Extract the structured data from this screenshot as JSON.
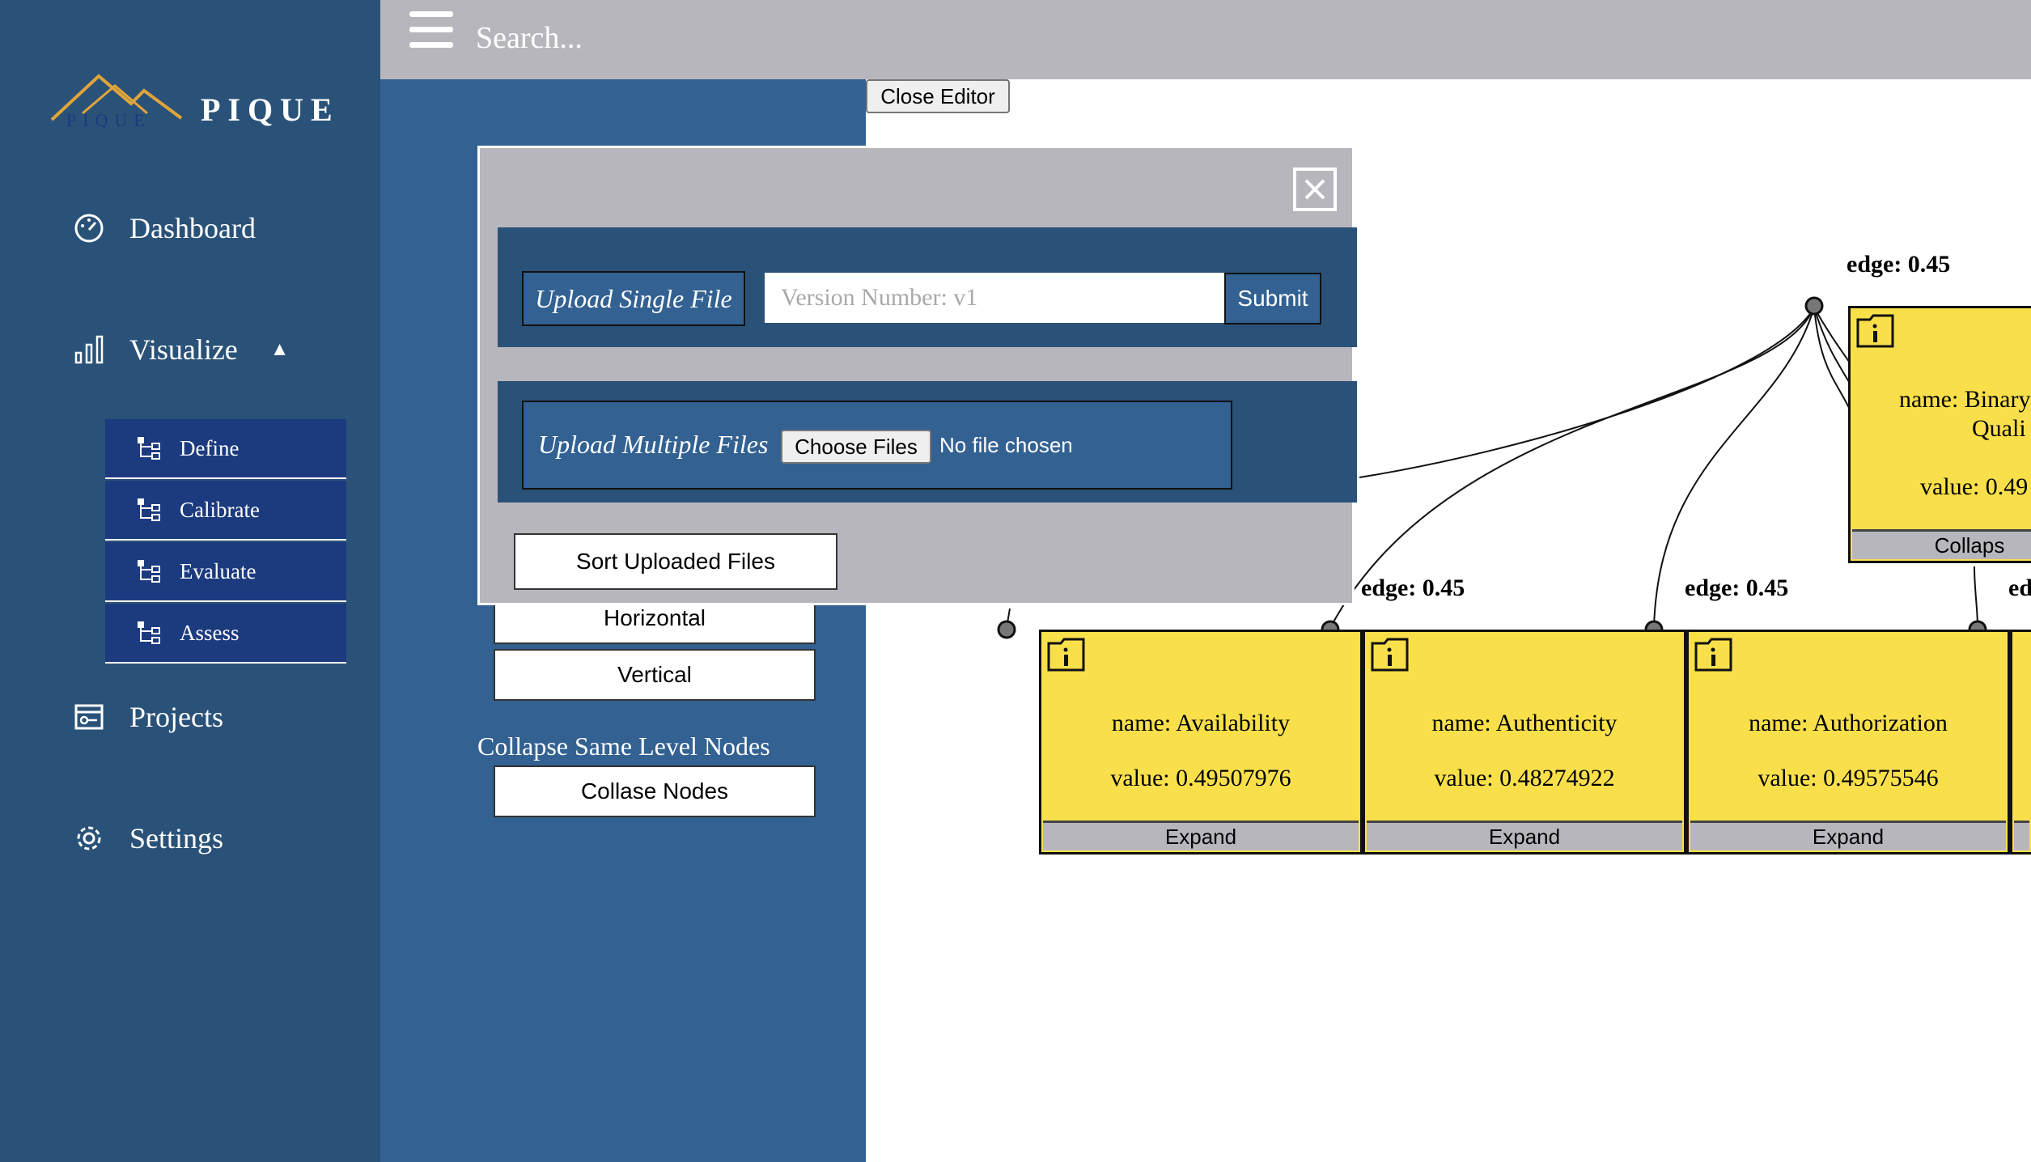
{
  "brand": {
    "logo_mark": "PIQUE",
    "name": "PIQUE"
  },
  "sidebar": {
    "items": [
      {
        "label": "Dashboard",
        "icon": "gauge-icon"
      },
      {
        "label": "Visualize",
        "icon": "bar-chart-icon"
      },
      {
        "label": "Projects",
        "icon": "projects-icon"
      },
      {
        "label": "Settings",
        "icon": "gear-icon"
      }
    ],
    "visualize_subitems": [
      {
        "label": "Define",
        "icon": "tree-icon"
      },
      {
        "label": "Calibrate",
        "icon": "tree-icon"
      },
      {
        "label": "Evaluate",
        "icon": "tree-icon"
      },
      {
        "label": "Assess",
        "icon": "tree-icon"
      }
    ]
  },
  "topbar": {
    "search_placeholder": "Search..."
  },
  "panel": {
    "horizontal_label": "Horizontal",
    "vertical_label": "Vertical",
    "collapse_heading": "Collapse Same Level Nodes",
    "collapse_button": "Collase Nodes"
  },
  "editor": {
    "close_label": "Close Editor"
  },
  "modal": {
    "single_label": "Upload Single File",
    "version_placeholder": "Version Number: v1",
    "submit_label": "Submit",
    "multi_label": "Upload Multiple Files",
    "choose_label": "Choose Files",
    "no_file_text": "No file chosen",
    "sort_label": "Sort Uploaded Files"
  },
  "graph": {
    "root_edge": "edge: 0.45",
    "top_node": {
      "name": "name: Binary",
      "name2": "Quali",
      "value": "value: 0.49",
      "button": "Collaps"
    },
    "nodes": [
      {
        "edge": "",
        "name": "name: Availability",
        "value": "value: 0.49507976",
        "button": "Expand"
      },
      {
        "edge": "edge: 0.45",
        "name": "name: Authenticity",
        "value": "value: 0.48274922",
        "button": "Expand"
      },
      {
        "edge": "edge: 0.45",
        "name": "name: Authorization",
        "value": "value: 0.49575546",
        "button": "Expand"
      }
    ],
    "partial_edge": "ed"
  },
  "colors": {
    "sidebar": "#2a5278",
    "subnav": "#1c3a7e",
    "panel": "#326192",
    "node": "#f9e04b",
    "topbar": "#b8b6bd"
  }
}
